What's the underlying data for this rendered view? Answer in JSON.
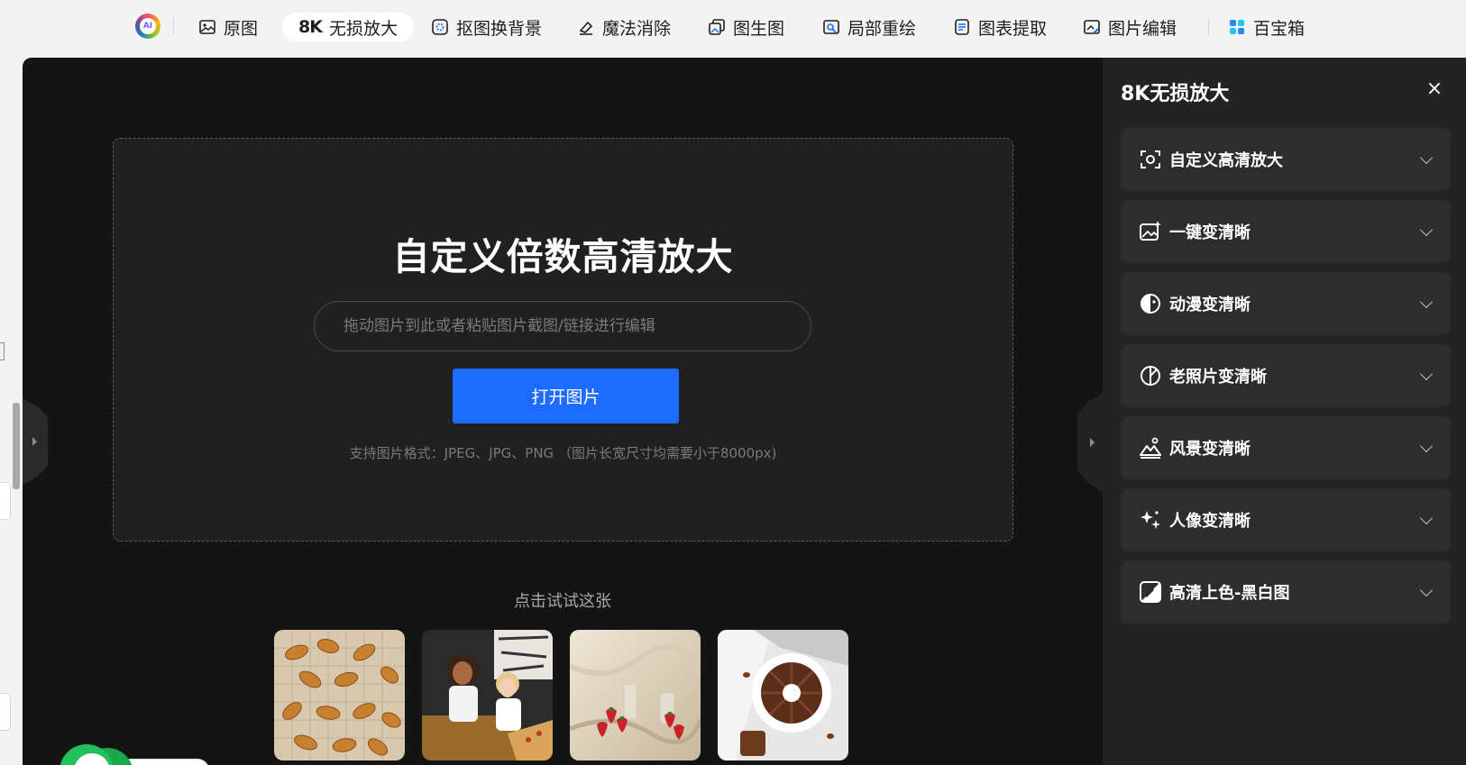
{
  "toolbar": {
    "logo_text": "AI",
    "items": [
      {
        "label": "原图",
        "icon": "image-icon"
      },
      {
        "badge": "8K",
        "label": "无损放大",
        "icon": "8k-icon",
        "active": true
      },
      {
        "label": "抠图换背景",
        "icon": "cutout-icon"
      },
      {
        "label": "魔法消除",
        "icon": "eraser-icon"
      },
      {
        "label": "图生图",
        "icon": "image-to-image-icon"
      },
      {
        "label": "局部重绘",
        "icon": "inpaint-icon"
      },
      {
        "label": "图表提取",
        "icon": "chart-extract-icon"
      },
      {
        "label": "图片编辑",
        "icon": "image-edit-icon"
      },
      {
        "label": "百宝箱",
        "icon": "toolbox-icon"
      }
    ]
  },
  "dropzone": {
    "title": "自定义倍数高清放大",
    "input_placeholder": "拖动图片到此或者粘贴图片截图/链接进行编辑",
    "button_label": "打开图片",
    "hint": "支持图片格式：JPEG、JPG、PNG （图片长宽尺寸均需要小于8000px)"
  },
  "samples": {
    "label": "点击试试这张",
    "items": [
      {
        "name": "croissants-photo"
      },
      {
        "name": "friends-pizza-photo"
      },
      {
        "name": "strawberries-photo"
      },
      {
        "name": "chocolate-cake-photo"
      }
    ]
  },
  "panel": {
    "title": "8K无损放大",
    "close_label": "×",
    "features": [
      {
        "label": "自定义高清放大",
        "icon": "custom-scan-icon"
      },
      {
        "label": "一键变清晰",
        "icon": "image-sparkle-icon"
      },
      {
        "label": "动漫变清晰",
        "icon": "anime-icon"
      },
      {
        "label": "老照片变清晰",
        "icon": "old-photo-icon"
      },
      {
        "label": "风景变清晰",
        "icon": "landscape-icon"
      },
      {
        "label": "人像变清晰",
        "icon": "portrait-sparkle-icon"
      },
      {
        "label": "高清上色-黑白图",
        "icon": "colorize-icon"
      }
    ]
  },
  "colors": {
    "accent": "#1d6cff",
    "workspace_bg": "#141414",
    "dropzone_bg": "#202020",
    "panel_bg": "#232323",
    "feature_bg": "#2d2d2d"
  }
}
